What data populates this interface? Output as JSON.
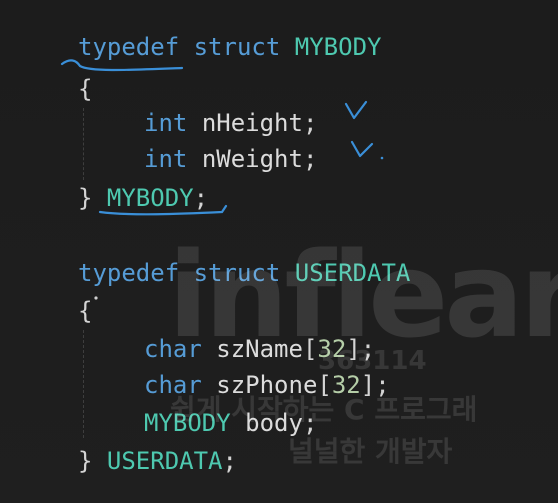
{
  "code": {
    "block1": {
      "kw_typedef": "typedef",
      "kw_struct": "struct",
      "tag": "MYBODY",
      "open_brace": "{",
      "members": [
        {
          "type": "int",
          "name": "nHeight",
          "end": ";"
        },
        {
          "type": "int",
          "name": "nWeight",
          "end": ";"
        }
      ],
      "close_brace": "}",
      "alias": "MYBODY",
      "end": ";"
    },
    "block2": {
      "kw_typedef": "typedef",
      "kw_struct": "struct",
      "tag": "USERDATA",
      "open_brace": "{",
      "members": [
        {
          "type": "char",
          "name": "szName",
          "lb": "[",
          "size": "32",
          "rb": "]",
          "end": ";"
        },
        {
          "type": "char",
          "name": "szPhone",
          "lb": "[",
          "size": "32",
          "rb": "]",
          "end": ";"
        },
        {
          "type": "MYBODY",
          "name": "body",
          "end": ";"
        }
      ],
      "close_brace": "}",
      "alias": "USERDATA",
      "end": ";"
    }
  },
  "watermark": {
    "logo": "inflearn",
    "course_code": "363114",
    "course_title": "쉽게 시작하는 C 프로그래",
    "author": "널널한 개발자"
  },
  "colors": {
    "background": "#1e1e1e",
    "keyword": "#569cd6",
    "type_name": "#4ec9b0",
    "identifier": "#dcdcdc",
    "number": "#b5cea8",
    "annotation": "#3a8fd8"
  }
}
